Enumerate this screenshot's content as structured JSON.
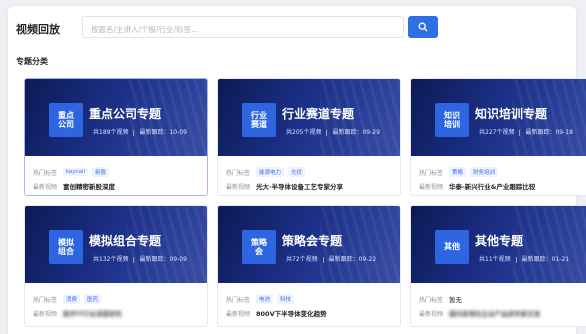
{
  "page": {
    "title": "视频回放",
    "section_title": "专题分类",
    "search": {
      "placeholder": "按题名/主讲人/个股/行业/标签..."
    }
  },
  "row_labels": {
    "hot_tags": "热门标签",
    "latest": "最新视频"
  },
  "cards": [
    {
      "badge": "重点\n公司",
      "title": "重点公司专题",
      "count": "共189个视频",
      "updated": "最新跟踪：10-09",
      "tags": [
        "keycall",
        "新股"
      ],
      "latest": "富创精密新股深度",
      "latest_blurred": false,
      "latest_plain": false
    },
    {
      "badge": "行业\n赛道",
      "title": "行业赛道专题",
      "count": "共205个视频",
      "updated": "最新跟踪：09-29",
      "tags": [
        "能源电力",
        "光伏"
      ],
      "latest": "光大·半导体设备工艺专家分享",
      "latest_blurred": false,
      "latest_plain": false
    },
    {
      "badge": "知识\n培训",
      "title": "知识培训专题",
      "count": "共227个视频",
      "updated": "最新跟踪：09-18",
      "tags": [
        "策略",
        "财务培训"
      ],
      "latest": "华泰-新兴行业&产业跟踪比较",
      "latest_blurred": false,
      "latest_plain": false
    },
    {
      "badge": "模拟\n组合",
      "title": "模拟组合专题",
      "count": "共132个视频",
      "updated": "最新跟踪：09-09",
      "tags": [
        "消费",
        "医药"
      ],
      "latest": "医疗IT行业深度研究",
      "latest_blurred": true,
      "latest_plain": false
    },
    {
      "badge": "策略\n会",
      "title": "策略会专题",
      "count": "共72个视频",
      "updated": "最新跟踪：09-22",
      "tags": [
        "电池",
        "科技"
      ],
      "latest": "800V下半导体变化趋势",
      "latest_blurred": false,
      "latest_plain": false
    },
    {
      "badge": "其他",
      "title": "其他专题",
      "count": "共11个视频",
      "updated": "最新跟踪：01-21",
      "tags": [],
      "tags_empty": "暂无",
      "latest": "国内某领先企业产品线专家交流",
      "latest_blurred": true,
      "latest_plain": false
    }
  ],
  "colors": {
    "accent": "#2f6fe4",
    "banner_dark": "#0d1a55",
    "badge": "#2d66e0",
    "tag_bg": "#eef3ff",
    "tag_fg": "#3b6ee6"
  },
  "icons": {
    "search_button": "search-icon"
  }
}
